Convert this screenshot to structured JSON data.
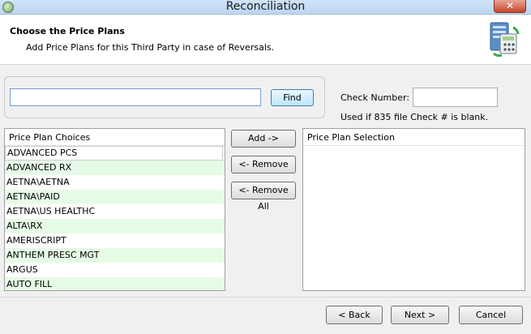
{
  "window": {
    "title": "Reconciliation",
    "close_glyph": "✕"
  },
  "header": {
    "title": "Choose the Price Plans",
    "subtitle": "Add Price Plans for this Third Party in case of Reversals."
  },
  "search": {
    "value": "",
    "find_label": "Find"
  },
  "check": {
    "label": "Check Number:",
    "value": "",
    "hint": "Used if 835 file Check # is blank."
  },
  "choices": {
    "header": "Price Plan Choices",
    "items": [
      "ADVANCED PCS",
      "ADVANCED RX",
      "AETNA\\AETNA",
      "AETNA\\PAID",
      "AETNA\\US HEALTHC",
      "ALTA\\RX",
      "AMERISCRIPT",
      "ANTHEM PRESC MGT",
      "ARGUS",
      "AUTO FILL"
    ]
  },
  "actions": {
    "add": "Add ->",
    "remove": "<- Remove",
    "remove_all": "<- Remove All"
  },
  "selection": {
    "header": "Price Plan Selection",
    "items": []
  },
  "footer": {
    "back": "< Back",
    "next": "Next >",
    "cancel": "Cancel"
  },
  "colors": {
    "row_alt": "#e6fbe6",
    "title_bar": "#c4dbf4",
    "close": "#c7452c"
  }
}
